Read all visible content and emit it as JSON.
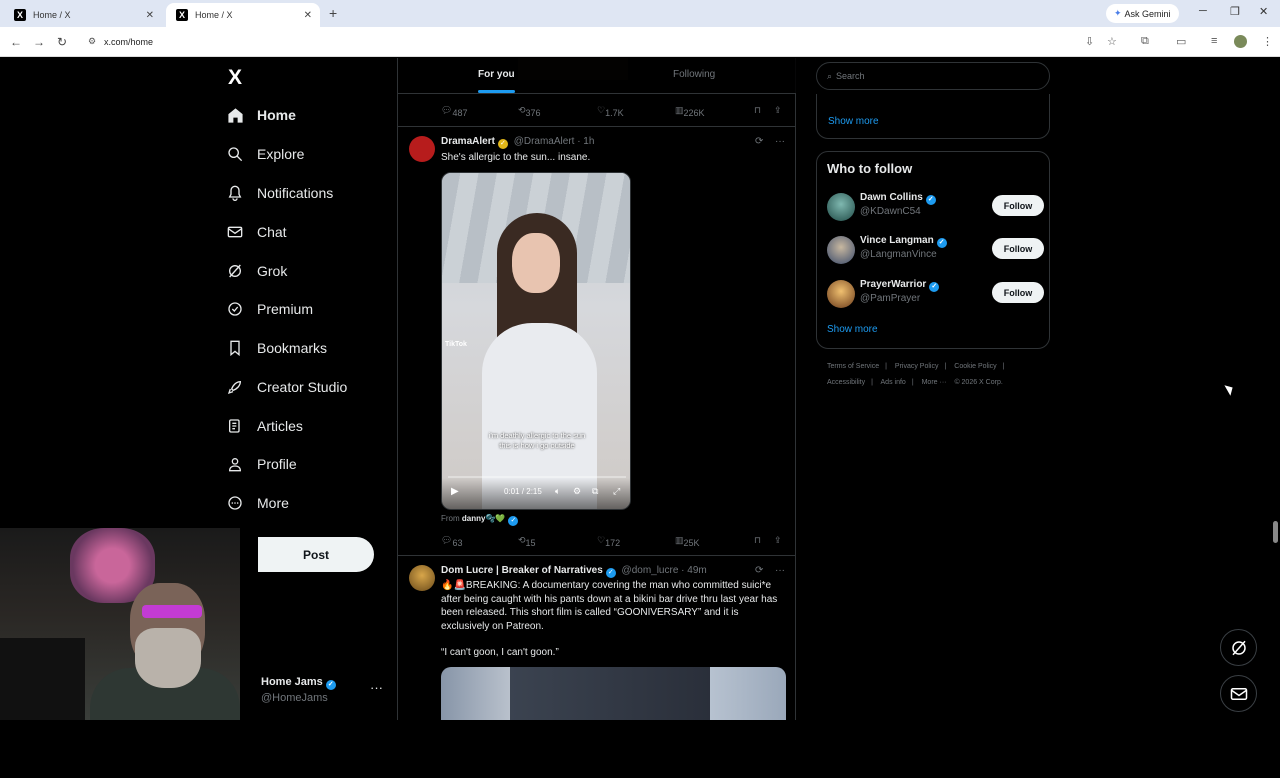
{
  "browser": {
    "tabs": [
      {
        "title": "Home / X"
      },
      {
        "title": "Home / X"
      }
    ],
    "gemini_label": "Ask Gemini",
    "url": "x.com/home"
  },
  "nav": {
    "logo": "X",
    "items": [
      {
        "label": "Home",
        "icon": "home-icon"
      },
      {
        "label": "Explore",
        "icon": "search-icon"
      },
      {
        "label": "Notifications",
        "icon": "bell-icon"
      },
      {
        "label": "Chat",
        "icon": "mail-icon"
      },
      {
        "label": "Grok",
        "icon": "grok-icon"
      },
      {
        "label": "Premium",
        "icon": "verified-icon"
      },
      {
        "label": "Bookmarks",
        "icon": "bookmark-icon"
      },
      {
        "label": "Creator Studio",
        "icon": "rocket-icon"
      },
      {
        "label": "Articles",
        "icon": "article-icon"
      },
      {
        "label": "Profile",
        "icon": "person-icon"
      },
      {
        "label": "More",
        "icon": "more-circle-icon"
      }
    ],
    "post_label": "Post",
    "account": {
      "name": "Home Jams",
      "handle": "@HomeJams"
    }
  },
  "timeline": {
    "tabs": [
      {
        "label": "For you"
      },
      {
        "label": "Following"
      }
    ],
    "prev_actions": {
      "replies": "487",
      "reposts": "376",
      "likes": "1.7K",
      "views": "226K"
    },
    "post1": {
      "name": "DramaAlert",
      "handle": "@DramaAlert",
      "time": "· 1h",
      "text": "She's allergic to the sun... insane.",
      "video": {
        "watermark": "TikTok",
        "caption_line1": "i'm deathly allergic to the sun",
        "caption_line2": "this is how i go outside",
        "time": "0:01 / 2:15"
      },
      "from_label": "From",
      "from_name": "danny🫧💚",
      "actions": {
        "replies": "63",
        "reposts": "15",
        "likes": "172",
        "views": "25K"
      }
    },
    "post2": {
      "name": "Dom Lucre | Breaker of Narratives",
      "handle": "@dom_lucre",
      "time": "· 49m",
      "text": "🔥🚨BREAKING: A documentary covering the man who committed suici*e after being caught with his pants down at a bikini bar drive thru last year has been released. This short film is called “GOONIVERSARY” and it is exclusively on Patreon.",
      "quote": "“I can't goon, I can't goon.”"
    }
  },
  "sidebar": {
    "search_placeholder": "Search",
    "trends_show_more": "Show more",
    "who_to_follow": {
      "title": "Who to follow",
      "follow_label": "Follow",
      "users": [
        {
          "name": "Dawn Collins",
          "handle": "@KDawnC54"
        },
        {
          "name": "Vince Langman",
          "handle": "@LangmanVince"
        },
        {
          "name": "PrayerWarrior",
          "handle": "@PamPrayer"
        }
      ],
      "show_more": "Show more"
    },
    "footer": {
      "line1": [
        "Terms of Service",
        "|",
        "Privacy Policy",
        "|",
        "Cookie Policy",
        "|"
      ],
      "line2": [
        "Accessibility",
        "|",
        "Ads info",
        "|",
        "More ···",
        "© 2026 X Corp."
      ]
    }
  }
}
